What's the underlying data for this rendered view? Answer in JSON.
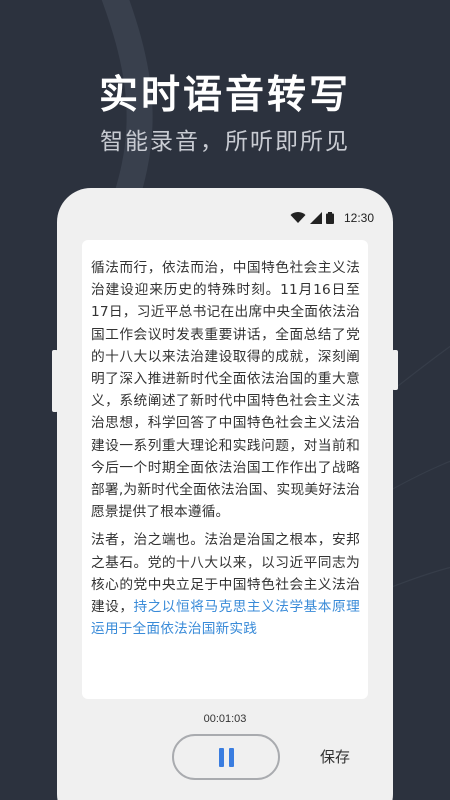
{
  "hero": {
    "title": "实时语音转写",
    "subtitle": "智能录音，所听即所见"
  },
  "status_bar": {
    "time": "12:30",
    "icons": [
      "wifi-icon",
      "signal-icon",
      "battery-icon"
    ]
  },
  "transcript": {
    "paragraph1": "循法而行，依法而治，中国特色社会主义法治建设迎来历史的特殊时刻。11月16日至17日，习近平总书记在出席中央全面依法治国工作会议时发表重要讲话，全面总结了党的十八大以来法治建设取得的成就，深刻阐明了深入推进新时代全面依法治国的重大意义，系统阐述了新时代中国特色社会主义法治思想，科学回答了中国特色社会主义法治建设一系列重大理论和实践问题，对当前和今后一个时期全面依法治国工作作出了战略部署,为新时代全面依法治国、实现美好法治愿景提供了根本遵循。",
    "paragraph2_plain": "法者，治之端也。法治是治国之根本，安邦之基石。党的十八大以来，以习近平同志为核心的党中央立足于中国特色社会主义法治建设，",
    "paragraph2_highlight": "持之以恒将马克思主义法学基本原理运用于全面依法治国新实践"
  },
  "recorder": {
    "timer": "00:01:03",
    "pause_icon": "pause-icon",
    "save_label": "保存"
  },
  "colors": {
    "background": "#2c323e",
    "phone": "#f0f0f0",
    "accent": "#3a7de0",
    "highlight_text": "#3a8bd8"
  }
}
